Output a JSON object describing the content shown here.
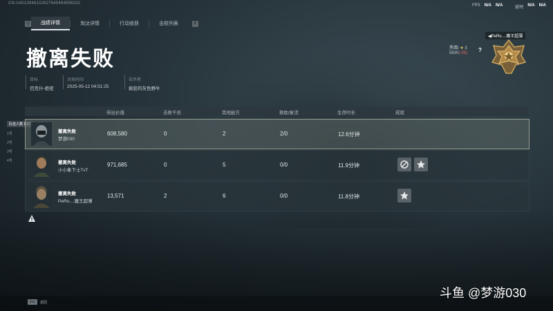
{
  "topbar": {
    "id_text": "CN-U4013946102627645494598232",
    "fps_label": "FPS",
    "fps_value": "N/A",
    "fps_value2": "N/A",
    "latency_label": "延时",
    "latency_value": "N/A",
    "latency_value2": "N/A"
  },
  "tabs": {
    "key_left": "Q",
    "key_right": "E",
    "items": [
      {
        "label": "战绩详情"
      },
      {
        "label": "淘汰详情"
      },
      {
        "label": "行动收获"
      },
      {
        "label": "击败列表"
      }
    ]
  },
  "result_title": "撤离失败",
  "meta": {
    "target": {
      "label": "目标",
      "value": "巴克什-绝密"
    },
    "time": {
      "label": "对局时间",
      "value": "2025-05-12 04:51:25"
    },
    "killer": {
      "label": "击杀者",
      "value": "疯狂的灰色野牛"
    }
  },
  "rank": {
    "player_name": "◀PeRo....魔王超薄",
    "label": "黑鹰I",
    "stars": "3",
    "score": "5830",
    "delta": "(-35)",
    "help": "?"
  },
  "sidebar": {
    "items": [
      {
        "label": "队伍人数 1/20"
      },
      {
        "label": "1号"
      },
      {
        "label": "2号"
      },
      {
        "label": "3号"
      },
      {
        "label": "4号"
      }
    ]
  },
  "table": {
    "headers": [
      "带出价值",
      "击败干员",
      "其他敌方",
      "救助/复活",
      "生存时长",
      "成就"
    ],
    "rows": [
      {
        "status": "撤离失败",
        "name": "梦游030",
        "value": "608,580",
        "kills": "0",
        "others": "2",
        "revive": "2/0",
        "survival": "12.6分钟",
        "achievements": []
      },
      {
        "status": "撤离失败",
        "name": "小小象下士TvT",
        "value": "971,685",
        "kills": "0",
        "others": "5",
        "revive": "0/0",
        "survival": "11.9分钟",
        "achievements": [
          "compass-medal-icon",
          "star-medal-icon"
        ]
      },
      {
        "status": "撤离失败",
        "name": "PeRo....魔王超薄",
        "value": "13,571",
        "kills": "2",
        "others": "6",
        "revive": "0/0",
        "survival": "11.8分钟",
        "achievements": [
          "star-medal-icon"
        ]
      }
    ]
  },
  "bottom": {
    "key": "Esc",
    "label": "返回"
  },
  "watermark": "斗鱼 @梦游030",
  "colors": {
    "accent": "#ffffff",
    "background": "#26333a",
    "selected_border": "#dcdcc8"
  }
}
